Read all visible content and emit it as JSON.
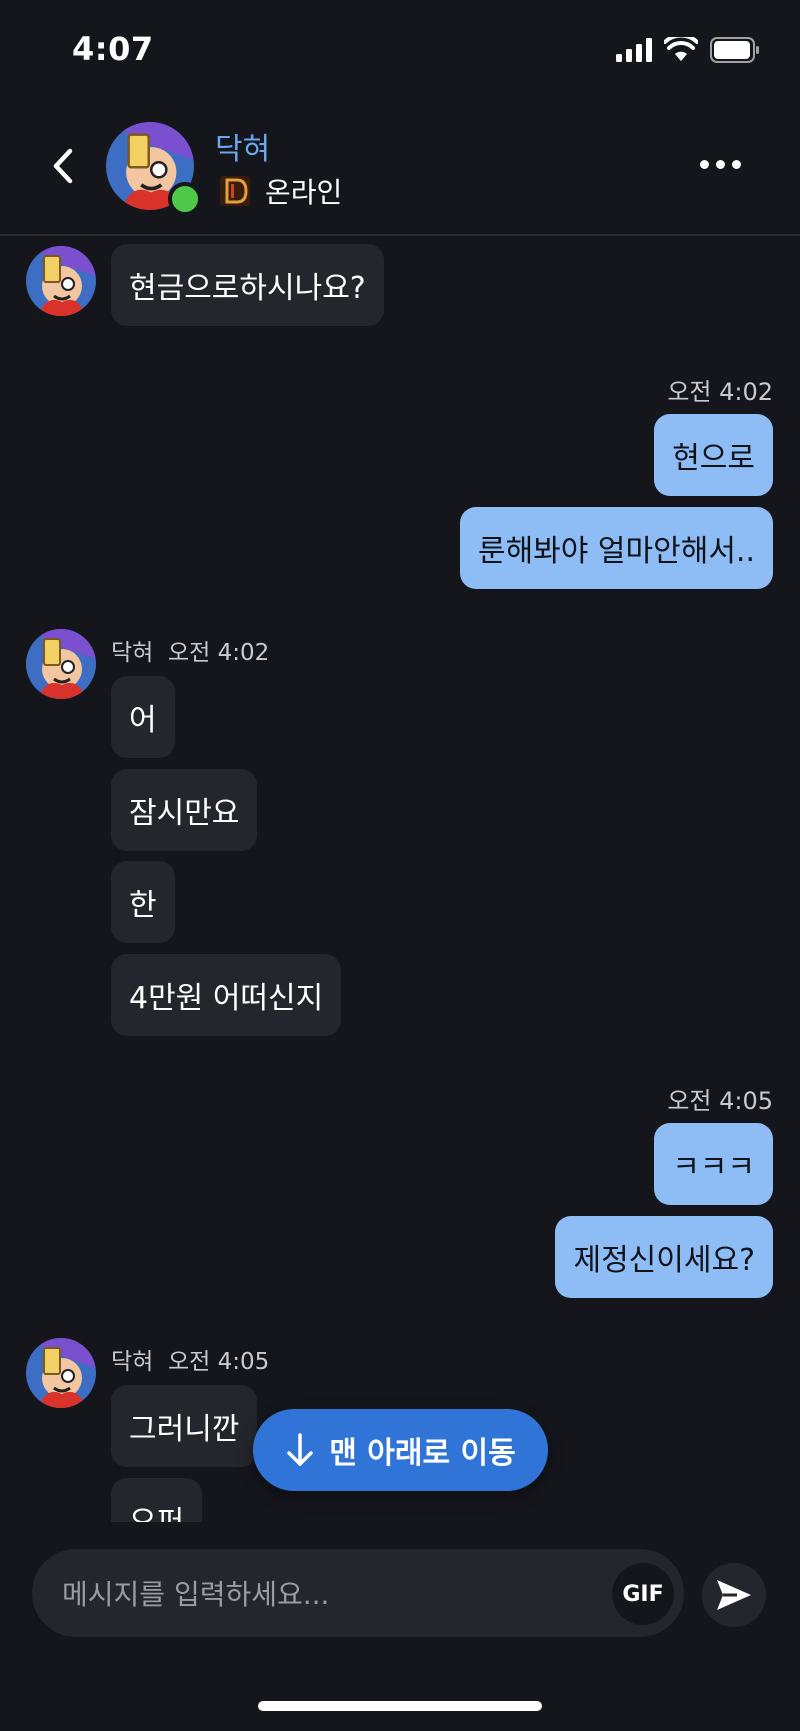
{
  "status_bar": {
    "time": "4:07"
  },
  "header": {
    "contact_name": "닥혀",
    "contact_status": "온라인"
  },
  "messages": [
    {
      "direction": "in",
      "text": "현금으로하시나요?"
    },
    {
      "direction": "out",
      "time": "오전 4:02",
      "text": "현으로"
    },
    {
      "direction": "out",
      "text": "룬해봐야 얼마안해서.."
    },
    {
      "direction": "in",
      "sender": "닥혀",
      "time": "오전 4:02",
      "text": "어"
    },
    {
      "direction": "in",
      "text": "잠시만요"
    },
    {
      "direction": "in",
      "text": "한"
    },
    {
      "direction": "in",
      "text": "4만원 어떠신지"
    },
    {
      "direction": "out",
      "time": "오전 4:05",
      "text": "ㅋㅋㅋ"
    },
    {
      "direction": "out",
      "text": "제정신이세요?"
    },
    {
      "direction": "in",
      "sender": "닥혀",
      "time": "오전 4:05",
      "text": "그러니깐"
    },
    {
      "direction": "in",
      "text": "오퍼"
    }
  ],
  "jump_button": {
    "label": "맨 아래로 이동"
  },
  "composer": {
    "placeholder": "메시지를 입력하세요...",
    "gif_label": "GIF"
  },
  "colors": {
    "background": "#15161c",
    "incoming_bubble": "#24262d",
    "outgoing_bubble": "#8ebdf6",
    "accent": "#2f74d6",
    "contact_name": "#6aa7ee",
    "online": "#4fc84a"
  },
  "icons": [
    "back-chevron-icon",
    "game-logo-icon",
    "more-icon",
    "arrow-down-icon",
    "send-icon",
    "signal-icon",
    "wifi-icon",
    "battery-icon"
  ]
}
